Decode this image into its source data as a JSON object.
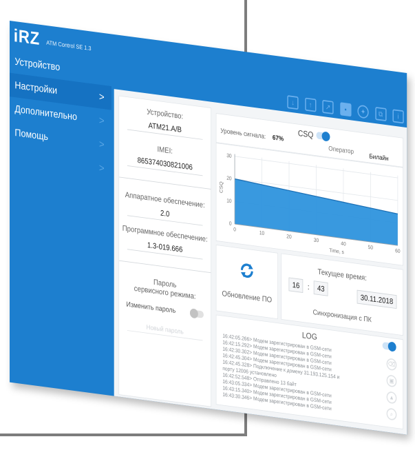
{
  "app": {
    "logo": "iRZ",
    "title": "ATM Control SE 1.3"
  },
  "menu": {
    "items": [
      {
        "label": "Устройство"
      },
      {
        "label": "Настройки"
      },
      {
        "label": "Дополнительно"
      },
      {
        "label": "Помощь"
      }
    ],
    "arrow": ">"
  },
  "toolbar": {
    "icons": [
      "download-icon",
      "upload-icon",
      "external-link-icon",
      "save-icon",
      "gear-icon",
      "copy-icon",
      "info-icon"
    ]
  },
  "device": {
    "device_label": "Устройство:",
    "device_value": "ATM21.A/B",
    "imei_label": "IMEI:",
    "imei_value": "865374030821006",
    "hardware_label": "Аппаратное обеспечение:",
    "hardware_value": "2.0",
    "software_label": "Программное обеспечение:",
    "software_value": "1.3-019.666",
    "service_password_label_1": "Пароль",
    "service_password_label_2": "сервисного режима:",
    "change_password_label": "Изменить пароль",
    "password_placeholder": "Новый пароль"
  },
  "signal": {
    "level_label": "Уровень сигнала:",
    "level_value": "67%",
    "csq_label": "CSQ",
    "operator_label": "Оператор",
    "operator_value": "Билайн"
  },
  "chart_data": {
    "type": "area",
    "x": [
      0,
      10,
      20,
      30,
      40,
      50,
      60
    ],
    "values": [
      20,
      19,
      18,
      17,
      16,
      15,
      14
    ],
    "xlabel": "Time, s",
    "ylabel": "CSQ",
    "ylim": [
      0,
      31
    ],
    "yticks": [
      0,
      10,
      20,
      30
    ],
    "xticks": [
      0,
      10,
      20,
      30,
      40,
      50,
      60
    ],
    "grid": true,
    "color": "#2e93dd"
  },
  "update": {
    "label": "Обновление ПО"
  },
  "time": {
    "label": "Текущее время:",
    "hours": "16",
    "separator": ":",
    "minutes": "43",
    "date": "30.11.2018",
    "sync_label": "Синхронизация с ПК"
  },
  "log": {
    "title": "LOG",
    "lines": [
      "16:42:05.266> Модем зарегистрирован в GSM-сети",
      "16:42:15.292> Модем зарегистрирован в GSM-сети",
      "16:42:30.302> Модем зарегистрирован в GSM-сети",
      "16:42:45.304> Модем зарегистрирован в GSM-сети",
      "16:42:45.328> Подключение к домену 31.193.125.154 и",
      "порту 12006 установлено",
      "16:42:52.548> Отправлено 13 байт",
      "16:43:05.334> Модем зарегистрирован в GSM-сети",
      "16:43:15.340> Модем зарегистрирован в GSM-сети",
      "16:43:30.346> Модем зарегистрирован в GSM-сети"
    ]
  }
}
